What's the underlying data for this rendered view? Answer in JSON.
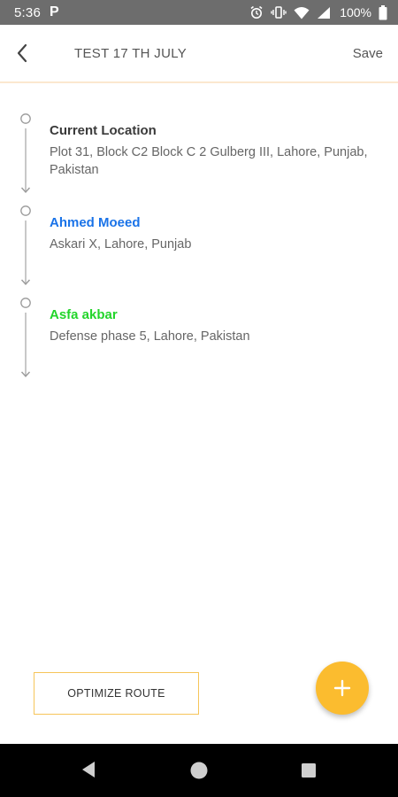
{
  "status_bar": {
    "time": "5:36",
    "app_glyph": "P",
    "battery": "100%",
    "icons": [
      "alarm-icon",
      "vibrate-icon",
      "wifi-icon",
      "signal-icon",
      "battery-icon"
    ]
  },
  "header": {
    "title": "TEST 17 TH JULY",
    "save_label": "Save",
    "back_icon": "back-chevron-icon"
  },
  "stops": [
    {
      "name": "Current Location",
      "address": "Plot 31, Block C2 Block C 2 Gulberg III, Lahore, Punjab, Pakistan",
      "name_color": "#3a3a3a"
    },
    {
      "name": "Ahmed Moeed",
      "address": "Askari X, Lahore, Punjab",
      "name_color": "#1a73e8"
    },
    {
      "name": "Asfa akbar",
      "address": "Defense phase 5, Lahore, Pakistan",
      "name_color": "#22d52a"
    }
  ],
  "actions": {
    "optimize_label": "OPTIMIZE ROUTE",
    "fab_icon": "plus-icon"
  },
  "colors": {
    "accent": "#fbbc2f",
    "header_divider": "#fbe8cf",
    "status_bar": "#6d6d6d"
  },
  "nav_bar": {
    "icons": [
      "back-triangle-icon",
      "home-circle-icon",
      "recents-square-icon"
    ]
  }
}
